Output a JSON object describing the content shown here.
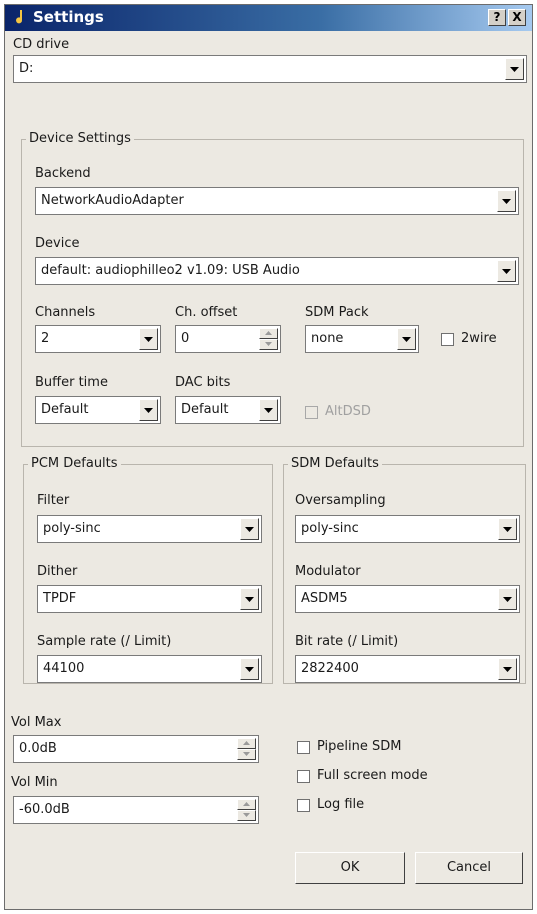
{
  "window": {
    "title": "Settings",
    "help_button": "?",
    "close_button": "X"
  },
  "cd_drive": {
    "label": "CD drive",
    "value": "D:"
  },
  "device_settings": {
    "title": "Device Settings",
    "backend_label": "Backend",
    "backend_value": "NetworkAudioAdapter",
    "device_label": "Device",
    "device_value": "default: audiophilleo2 v1.09: USB Audio",
    "channels_label": "Channels",
    "channels_value": "2",
    "ch_offset_label": "Ch. offset",
    "ch_offset_value": "0",
    "sdm_pack_label": "SDM Pack",
    "sdm_pack_value": "none",
    "twowire_label": "2wire",
    "buffer_time_label": "Buffer time",
    "buffer_time_value": "Default",
    "dac_bits_label": "DAC bits",
    "dac_bits_value": "Default",
    "altdsd_label": "AltDSD"
  },
  "pcm_defaults": {
    "title": "PCM Defaults",
    "filter_label": "Filter",
    "filter_value": "poly-sinc",
    "dither_label": "Dither",
    "dither_value": "TPDF",
    "sample_rate_label": "Sample rate (/ Limit)",
    "sample_rate_value": "44100"
  },
  "sdm_defaults": {
    "title": "SDM Defaults",
    "oversampling_label": "Oversampling",
    "oversampling_value": "poly-sinc",
    "modulator_label": "Modulator",
    "modulator_value": "ASDM5",
    "bit_rate_label": "Bit rate (/ Limit)",
    "bit_rate_value": "2822400"
  },
  "vol": {
    "max_label": "Vol Max",
    "max_value": "0.0dB",
    "min_label": "Vol Min",
    "min_value": "-60.0dB"
  },
  "options": {
    "pipeline_sdm": "Pipeline SDM",
    "full_screen": "Full screen mode",
    "log_file": "Log file"
  },
  "buttons": {
    "ok": "OK",
    "cancel": "Cancel"
  }
}
